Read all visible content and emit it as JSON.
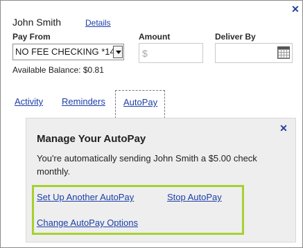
{
  "payee": {
    "name": "John Smith",
    "details_link": "Details"
  },
  "form": {
    "pay_from_label": "Pay From",
    "pay_from_value": "NO FEE CHECKING *14",
    "amount_label": "Amount",
    "amount_prefix": "$",
    "deliver_by_label": "Deliver By",
    "available_balance": "Available Balance: $0.81"
  },
  "tabs": [
    {
      "label": "Activity"
    },
    {
      "label": "Reminders"
    },
    {
      "label": "AutoPay",
      "active": true
    }
  ],
  "autopay": {
    "title": "Manage Your AutoPay",
    "message": "You're automatically sending John Smith a $5.00 check monthly.",
    "links": {
      "setup_another": "Set Up Another AutoPay",
      "stop": "Stop AutoPay",
      "change_options": "Change AutoPay Options"
    }
  },
  "icons": {
    "close": "close-icon",
    "calendar": "calendar-icon",
    "dropdown": "chevron-down-icon"
  },
  "colors": {
    "link": "#1b3ea8",
    "highlight": "#a6d12f",
    "panel_bg": "#eeeeee"
  }
}
